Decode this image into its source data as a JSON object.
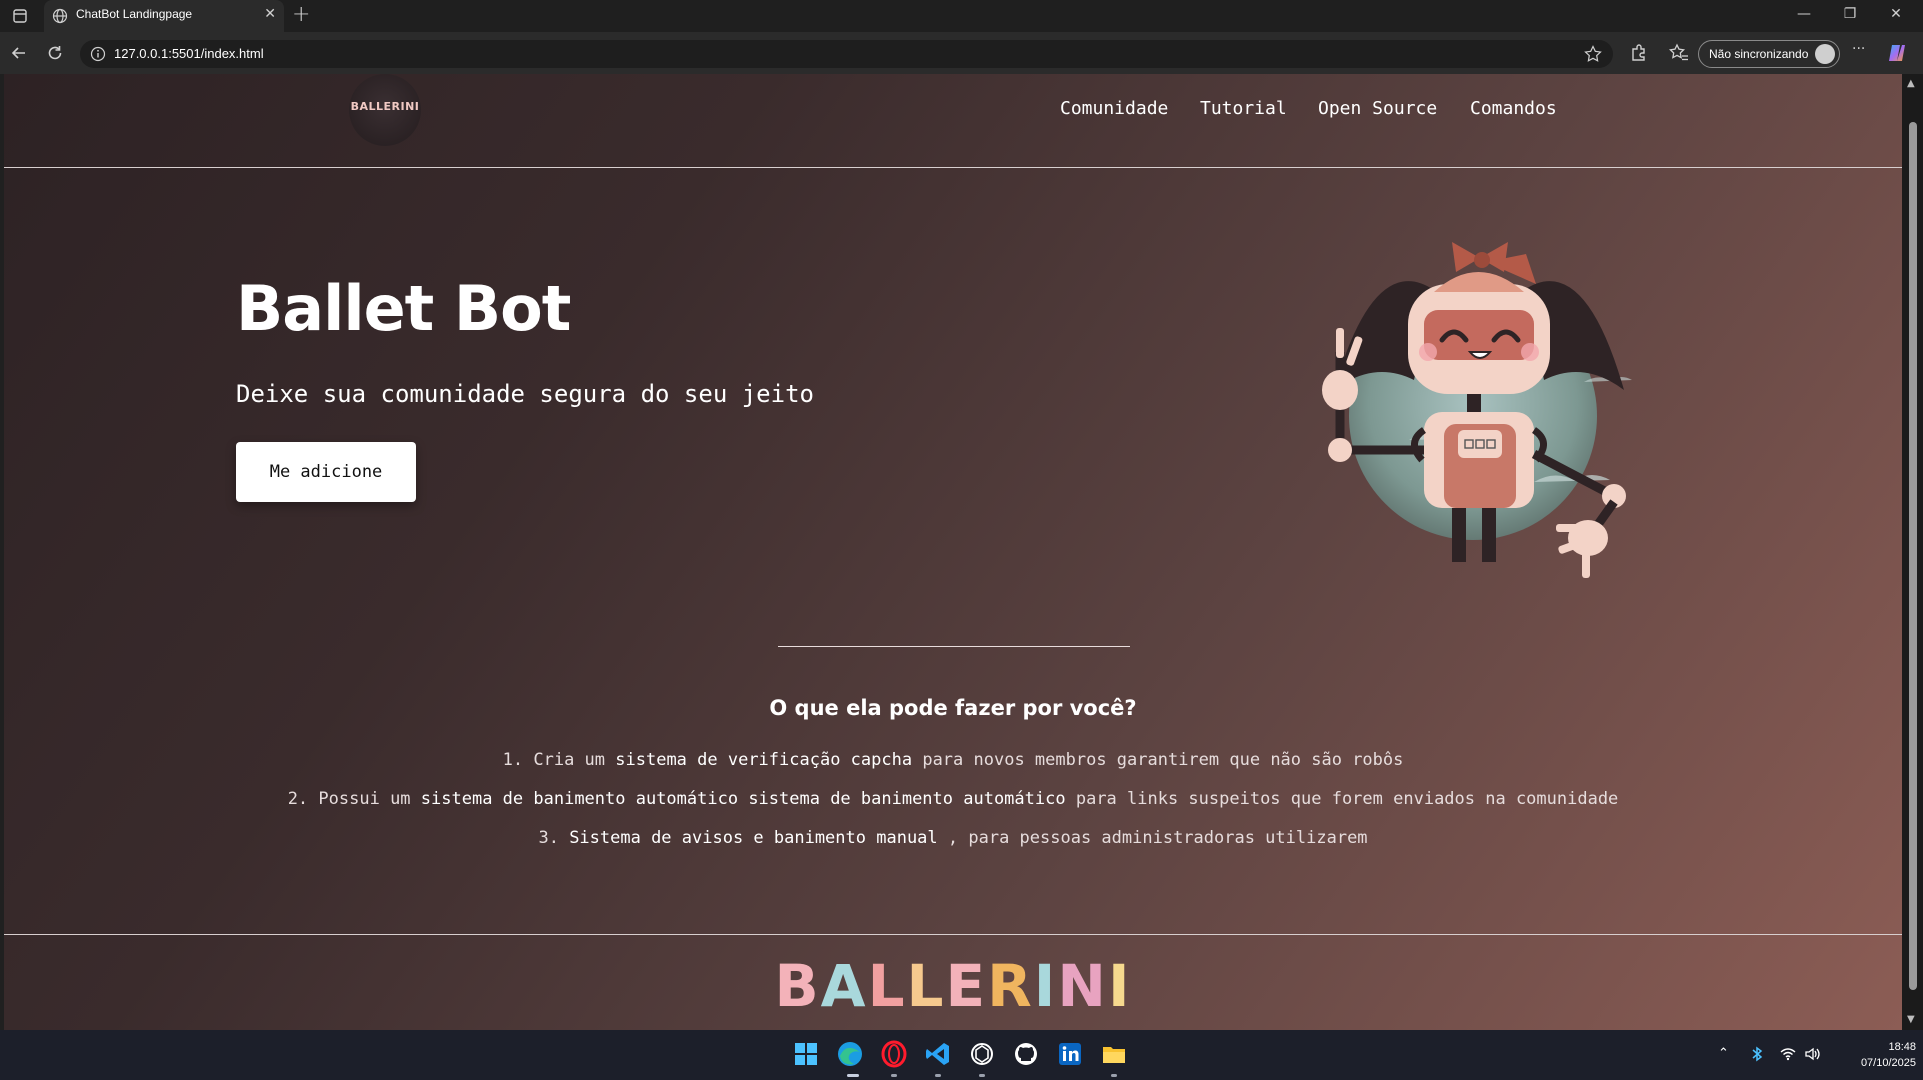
{
  "browser": {
    "tab_title": "ChatBot Landingpage",
    "tab_close": "✕",
    "new_tab": "+",
    "url": "127.0.0.1:5501/index.html",
    "profile_label": "Não sincronizando",
    "more": "···",
    "window": {
      "minimize": "—",
      "restore": "❐",
      "close": "✕"
    }
  },
  "site": {
    "logo_text": "BALLERINI",
    "nav": [
      "Comunidade",
      "Tutorial",
      "Open Source",
      "Comandos"
    ],
    "hero": {
      "title": "Ballet Bot",
      "subtitle": "Deixe sua comunidade segura do seu jeito",
      "cta": "Me adicione"
    },
    "features_title": "O que ela pode fazer por você?",
    "features": [
      {
        "num": "1.",
        "pre": "Cria um",
        "bold": "sistema de verificação capcha",
        "post": "para novos membros garantirem que não são robôs"
      },
      {
        "num": "2.",
        "pre": "Possui um",
        "bold": "sistema de banimento automático sistema de banimento automático",
        "post": "para links suspeitos que forem enviados na comunidade"
      },
      {
        "num": "3.",
        "pre": "",
        "bold": "Sistema de avisos e banimento manual",
        "post": ", para pessoas administradoras utilizarem"
      }
    ],
    "footer_logo": [
      "B",
      "A",
      "L",
      "L",
      "E",
      "R",
      "I",
      "N",
      "I"
    ],
    "footer_colors": [
      "#f3b2b9",
      "#a9d8dc",
      "#f1a0a0",
      "#f6c98e",
      "#f3b2b9",
      "#f0b55f",
      "#a9d8dc",
      "#e8a3c0",
      "#f6d98e"
    ]
  },
  "taskbar": {
    "time": "18:48",
    "date": "07/10/2025",
    "apps": [
      "windows-start",
      "edge",
      "opera",
      "vscode",
      "chatgpt",
      "github",
      "linkedin",
      "file-explorer"
    ]
  }
}
